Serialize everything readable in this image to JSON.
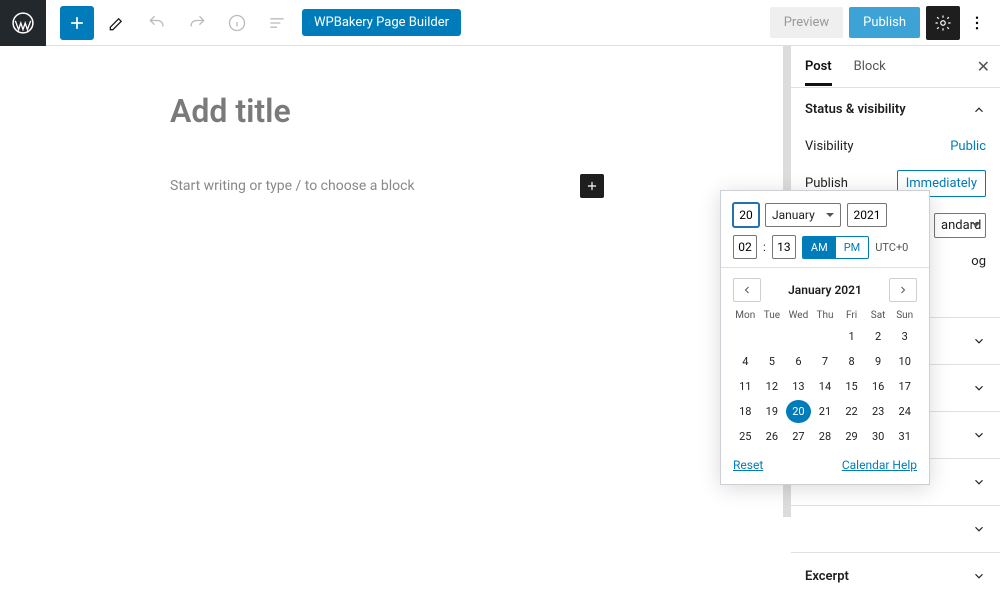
{
  "topbar": {
    "wpbakery": "WPBakery Page Builder",
    "preview": "Preview",
    "publish": "Publish"
  },
  "editor": {
    "title_placeholder": "Add title",
    "block_prompt": "Start writing or type / to choose a block"
  },
  "sidebar": {
    "tabs": {
      "post": "Post",
      "block": "Block"
    },
    "status_heading": "Status & visibility",
    "visibility_label": "Visibility",
    "visibility_value": "Public",
    "publish_label": "Publish",
    "publish_value": "Immediately",
    "format_partial": "andard",
    "blog_partial": "og",
    "excerpt": "Excerpt"
  },
  "datepicker": {
    "day": "20",
    "month": "January",
    "year": "2021",
    "hour": "02",
    "minute": "13",
    "am": "AM",
    "pm": "PM",
    "tz": "UTC+0",
    "cal_title": "January 2021",
    "dow": [
      "Mon",
      "Tue",
      "Wed",
      "Thu",
      "Fri",
      "Sat",
      "Sun"
    ],
    "days": [
      "",
      "",
      "",
      "",
      "1",
      "2",
      "3",
      "4",
      "5",
      "6",
      "7",
      "8",
      "9",
      "10",
      "11",
      "12",
      "13",
      "14",
      "15",
      "16",
      "17",
      "18",
      "19",
      "20",
      "21",
      "22",
      "23",
      "24",
      "25",
      "26",
      "27",
      "28",
      "29",
      "30",
      "31"
    ],
    "selected_day": "20",
    "reset": "Reset",
    "help": "Calendar Help"
  }
}
